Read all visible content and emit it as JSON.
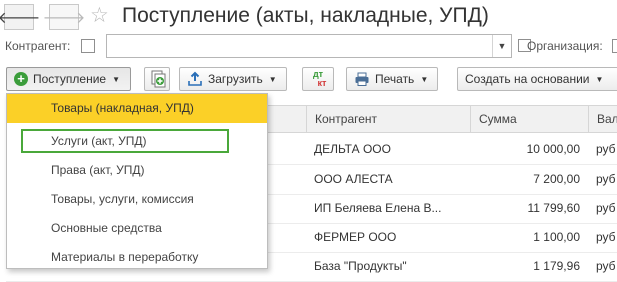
{
  "header": {
    "back_glyph": "🡐",
    "forward_glyph": "🡒",
    "star_glyph": "☆",
    "title": "Поступление (акты, накладные, УПД)"
  },
  "filters": {
    "counterparty_label": "Контрагент:",
    "counterparty_value": "",
    "combo_button_glyph": "▼",
    "organization_label": "Организация:"
  },
  "toolbar": {
    "postuplenie_label": "Поступление",
    "zagruzit_label": "Загрузить",
    "dtkt_top": "дт",
    "dtkt_bottom": "кт",
    "pechat_label": "Печать",
    "sozdat_label": "Создать на основании",
    "caret": "▼"
  },
  "table": {
    "headers": [
      "Контрагент",
      "Сумма",
      "Вал"
    ],
    "rows": [
      {
        "kontragent": "ДЕЛЬТА ООО",
        "summa": "10 000,00",
        "valyuta": "руб"
      },
      {
        "kontragent": "ООО АЛЕСТА",
        "summa": "7 200,00",
        "valyuta": "руб"
      },
      {
        "kontragent": "ИП Беляева Елена В...",
        "summa": "11 799,60",
        "valyuta": "руб"
      },
      {
        "kontragent": "ФЕРМЕР ООО",
        "summa": "1 100,00",
        "valyuta": "руб"
      },
      {
        "kontragent": "База \"Продукты\"",
        "summa": "1 179,96",
        "valyuta": "руб"
      }
    ]
  },
  "menu": {
    "items": [
      {
        "label": "Товары (накладная, УПД)",
        "active": true
      },
      {
        "label": "Услуги (акт, УПД)",
        "active": false,
        "outlined": true
      },
      {
        "label": "Права (акт, УПД)",
        "active": false
      },
      {
        "label": "Товары, услуги, комиссия",
        "active": false
      },
      {
        "label": "Основные средства",
        "active": false
      },
      {
        "label": "Материалы в переработку",
        "active": false
      }
    ]
  },
  "colors": {
    "active_item": "#fbd027",
    "outline": "#4aa83a",
    "add_icon": "#3b9d3b",
    "upload_icon": "#2a6fb8",
    "print_icon": "#4a6e96"
  }
}
